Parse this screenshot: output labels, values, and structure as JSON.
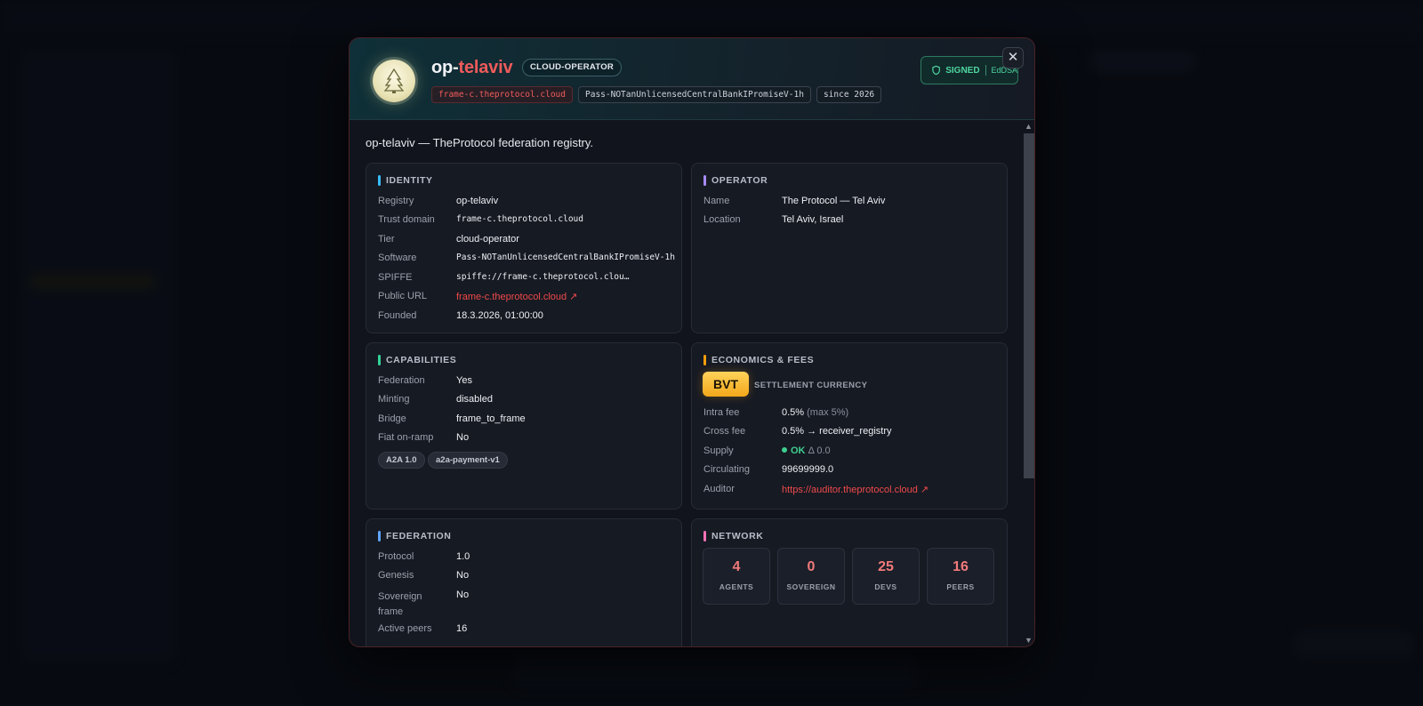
{
  "header": {
    "title_prefix": "op-",
    "title_suffix": "telaviv",
    "tier_badge": "CLOUD-OPERATOR",
    "chips": [
      "frame-c.theprotocol.cloud",
      "Pass-NOTanUnlicensedCentralBankIPromiseV-1h",
      "since 2026"
    ],
    "signed_label": "SIGNED",
    "signed_alg": "EdDSA",
    "close_symbol": "✕"
  },
  "intro": "op-telaviv — TheProtocol federation registry.",
  "identity": {
    "heading": "IDENTITY",
    "rows": [
      {
        "k": "Registry",
        "v": "op-telaviv"
      },
      {
        "k": "Trust domain",
        "v": "frame-c.theprotocol.cloud"
      },
      {
        "k": "Tier",
        "v": "cloud-operator"
      },
      {
        "k": "Software",
        "v": "Pass-NOTanUnlicensedCentralBankIPromiseV-1h"
      },
      {
        "k": "SPIFFE",
        "v": "spiffe://frame-c.theprotocol.clou…"
      },
      {
        "k": "Public URL",
        "v": "frame-c.theprotocol.cloud ↗"
      },
      {
        "k": "Founded",
        "v": "18.3.2026, 01:00:00"
      }
    ]
  },
  "operator": {
    "heading": "OPERATOR",
    "rows": [
      {
        "k": "Name",
        "v": "The Protocol — Tel Aviv"
      },
      {
        "k": "Location",
        "v": "Tel Aviv, Israel"
      }
    ]
  },
  "capabilities": {
    "heading": "CAPABILITIES",
    "rows": [
      {
        "k": "Federation",
        "v": "Yes"
      },
      {
        "k": "Minting",
        "v": "disabled"
      },
      {
        "k": "Bridge",
        "v": "frame_to_frame"
      },
      {
        "k": "Fiat on-ramp",
        "v": "No"
      }
    ],
    "tags": [
      "A2A 1.0",
      "a2a-payment-v1"
    ]
  },
  "economics": {
    "heading": "ECONOMICS & FEES",
    "currency": "BVT",
    "currency_label": "SETTLEMENT CURRENCY",
    "intra_label": "Intra fee",
    "intra_value": "0.5%",
    "intra_max": "(max 5%)",
    "cross_label": "Cross fee",
    "cross_value": "0.5% → receiver_registry",
    "supply_label": "Supply",
    "supply_status": "OK",
    "supply_delta": "Δ 0.0",
    "circulating_label": "Circulating",
    "circulating_value": "99699999.0",
    "auditor_label": "Auditor",
    "auditor_value": "https://auditor.theprotocol.cloud ↗"
  },
  "federation": {
    "heading": "FEDERATION",
    "rows": [
      {
        "k": "Protocol",
        "v": "1.0"
      },
      {
        "k": "Genesis",
        "v": "No"
      },
      {
        "k": "Sovereign frame",
        "v": "No"
      },
      {
        "k": "Active peers",
        "v": "16"
      }
    ]
  },
  "network": {
    "heading": "NETWORK",
    "stats": [
      {
        "n": "4",
        "l": "AGENTS"
      },
      {
        "n": "0",
        "l": "SOVEREIGN"
      },
      {
        "n": "25",
        "l": "DEVS"
      },
      {
        "n": "16",
        "l": "PEERS"
      }
    ]
  },
  "colors": {
    "accent_red": "#ef5b5b",
    "signed_green": "#4fd6a0",
    "bvt_gold": "#f3a81a",
    "identity_accent": "#38bdf8",
    "operator_accent": "#a78bfa",
    "capabilities_accent": "#34d399",
    "economics_accent": "#f59e0b",
    "federation_accent": "#60a5fa",
    "network_accent": "#f472b6"
  }
}
